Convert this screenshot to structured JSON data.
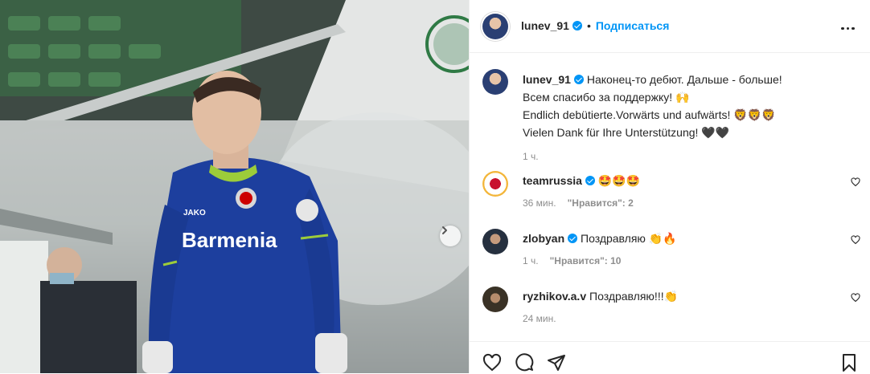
{
  "header": {
    "username": "lunev_91",
    "separator": "•",
    "follow_label": "Подписаться"
  },
  "caption": {
    "username": "lunev_91",
    "lines": [
      "Наконец-то дебют. Дальше - больше!",
      "Всем спасибо за поддержку! 🙌",
      "Endlich debütierte.Vorwärts und aufwärts! 🦁🦁🦁",
      "Vielen Dank für Ihre Unterstützung! 🖤🖤"
    ],
    "time": "1 ч."
  },
  "comments": [
    {
      "username": "teamrussia",
      "verified": true,
      "text": "🤩🤩🤩",
      "time": "36 мин.",
      "likes": "\"Нравится\": 2"
    },
    {
      "username": "zlobyan",
      "verified": true,
      "text": "Поздравляю 👏🔥",
      "time": "1 ч.",
      "likes": "\"Нравится\": 10"
    },
    {
      "username": "ryzhikov.a.v",
      "verified": false,
      "text": "Поздравляю!!!👏",
      "time": "24 мин.",
      "likes": ""
    }
  ],
  "photo": {
    "jersey_text": "Barmenia",
    "jersey_brand": "JAKO"
  },
  "colors": {
    "accent": "#0095f6",
    "jersey": "#1d3f9e",
    "verified": "#0095f6"
  },
  "icons": [
    "chevron-right-icon",
    "more-icon",
    "verified-icon",
    "heart-icon",
    "comment-icon",
    "share-icon",
    "bookmark-icon"
  ]
}
